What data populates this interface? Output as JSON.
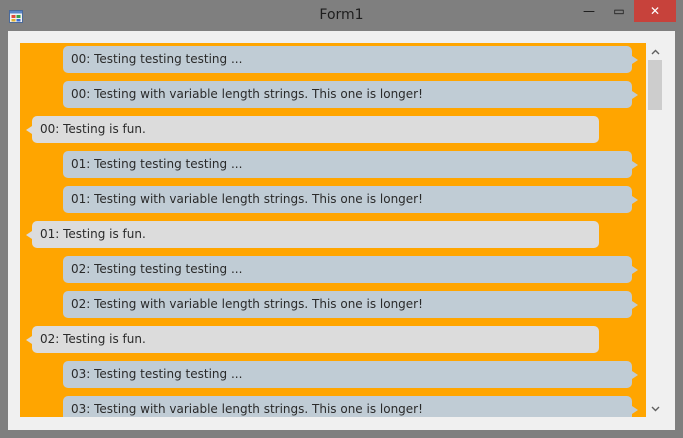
{
  "window": {
    "title": "Form1",
    "minimize_glyph": "—",
    "maximize_glyph": "▭",
    "close_glyph": "✕",
    "icons": {
      "app": "form-app-icon",
      "minimize": "minimize-icon",
      "maximize": "maximize-icon",
      "close": "close-icon"
    }
  },
  "colors": {
    "list_background": "#ffa500",
    "outgoing_bubble": "#c0ccd5",
    "incoming_bubble": "#dcdcdc",
    "close_button": "#c7423b"
  },
  "scrollbar": {
    "up_icon": "chevron-up-icon",
    "down_icon": "chevron-down-icon"
  },
  "messages": [
    {
      "text": "00: Testing testing testing ...",
      "side": "right"
    },
    {
      "text": "00: Testing with variable length strings.  This one is longer!",
      "side": "right"
    },
    {
      "text": "00: Testing is fun.",
      "side": "left"
    },
    {
      "text": "01: Testing testing testing ...",
      "side": "right"
    },
    {
      "text": "01: Testing with variable length strings.  This one is longer!",
      "side": "right"
    },
    {
      "text": "01: Testing is fun.",
      "side": "left"
    },
    {
      "text": "02: Testing testing testing ...",
      "side": "right"
    },
    {
      "text": "02: Testing with variable length strings.  This one is longer!",
      "side": "right"
    },
    {
      "text": "02: Testing is fun.",
      "side": "left"
    },
    {
      "text": "03: Testing testing testing ...",
      "side": "right"
    },
    {
      "text": "03: Testing with variable length strings.  This one is longer!",
      "side": "right"
    }
  ]
}
